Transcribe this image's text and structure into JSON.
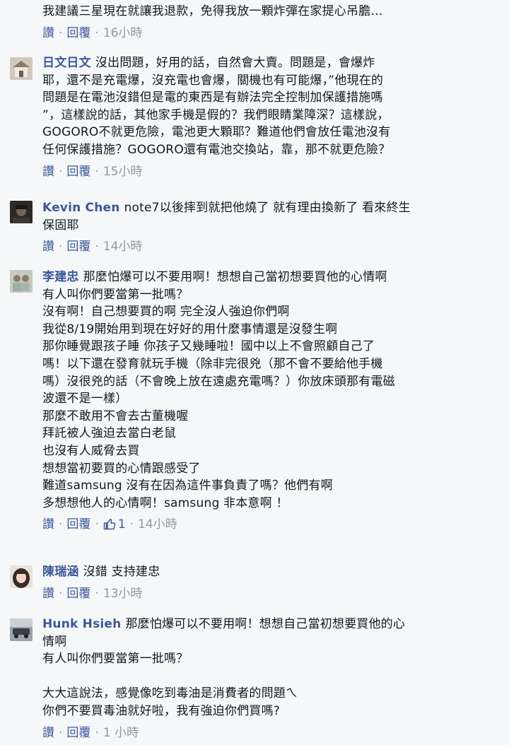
{
  "labels": {
    "like": "讚",
    "reply": "回覆",
    "dot": "·"
  },
  "colors": {
    "link": "#3b5998",
    "meta": "#9197a3",
    "text": "#141823",
    "bg": "#f6f7f9"
  },
  "comments": [
    {
      "author": "",
      "lines": [
        "我建議三星現在就讓我退款，免得我放一顆炸彈在家提心吊膽…"
      ],
      "time": "16小時",
      "likes": ""
    },
    {
      "author": "日文日文",
      "lines": [
        "沒出問題，好用的話，自然會大賣。問題是，會爆炸",
        "耶，還不是充電爆，沒充電也會爆，關機也有可能爆，”他現在的",
        "問題是在電池沒錯但是電的東西是有辦法完全控制加保護措施嗎",
        "”，這樣說的話，其他家手機是假的？我們眼睛業障深？這樣說，",
        "GOGORO不就更危險，電池更大顆耶？難道他們會放任電池沒有",
        "任何保護措施？GOGORO還有電池交換站，靠，那不就更危險？"
      ],
      "time": "15小時",
      "likes": ""
    },
    {
      "author": "Kevin Chen",
      "lines": [
        "note7以後摔到就把他燒了 就有理由換新了 看來終生",
        "保固耶"
      ],
      "time": "14小時",
      "likes": ""
    },
    {
      "author": "李建忠",
      "lines": [
        "那麼怕爆可以不要用啊！想想自己當初想要買他的心情啊",
        "有人叫你們要當第一批嗎？",
        "沒有啊！自己想要買的啊 完全沒人強迫你們啊",
        "我從8/19開始用到現在好好的用什麼事情還是沒發生啊",
        "那你睡覺跟孩子睡 你孩子又幾睡啦！國中以上不會照顧自己了",
        "嗎！以下還在發育就玩手機（除非完很兇（那不會不要給他手機",
        "嗎）沒很兇的話（不會晚上放在遠處充電嗎？）你放床頭那有電磁",
        "波還不是一樣）",
        "那麼不敢用不會去古董機喔",
        "拜託被人強迫去當白老鼠",
        "也沒有人威脅去買",
        "想想當初要買的心情跟感受了",
        "難道samsung 沒有在因為這件事負責了嗎？他們有啊",
        "多想想他人的心情啊！samsung 非本意啊 ！"
      ],
      "time": "14小時",
      "likes": "1"
    },
    {
      "author": "陳瑞涵",
      "lines": [
        "沒錯 支持建忠"
      ],
      "time": "13小時",
      "likes": ""
    },
    {
      "author": "Hunk Hsieh",
      "lines": [
        "那麼怕爆可以不要用啊！想想自己當初想要買他的心",
        "情啊",
        "有人叫你們要當第一批嗎？",
        "",
        "大大這說法，感覺像吃到毒油是消費者的問題ㄟ",
        "你們不要買毒油就好啦，我有強迫你們買嗎?"
      ],
      "time": "1 小時",
      "likes": ""
    }
  ]
}
